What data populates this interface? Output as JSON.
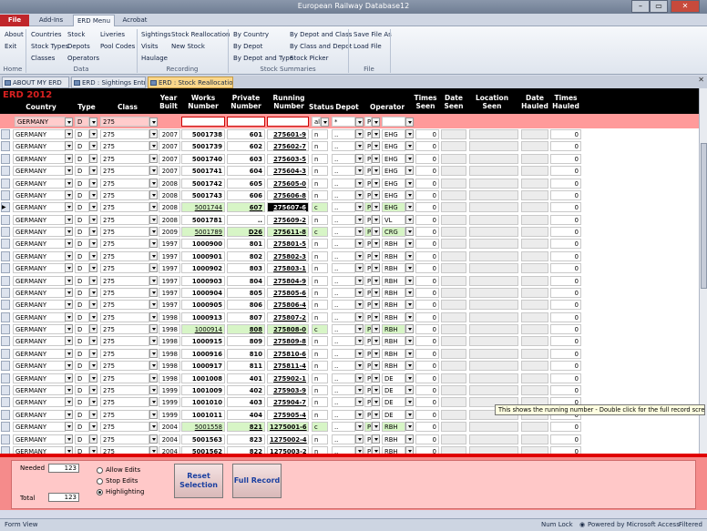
{
  "window": {
    "title": "European Railway Database12",
    "min": "–",
    "max": "▭",
    "close": "✕"
  },
  "ribbon_tabs": [
    "File",
    "Add-Ins",
    "ERD Menu",
    "Acrobat"
  ],
  "ribbon": {
    "home": {
      "items": [
        "About",
        "Exit"
      ],
      "label": "Home"
    },
    "data": {
      "items": [
        "Countries",
        "Stock",
        "Liveries",
        "Stock Types",
        "Depots",
        "Pool Codes",
        "Classes",
        "Operators"
      ],
      "label": "Data"
    },
    "recording": {
      "items": [
        "Sightings",
        "Stock Reallocation",
        "Visits",
        "New Stock",
        "Haulage"
      ],
      "label": "Recording"
    },
    "summaries": {
      "items": [
        "By Country",
        "By Depot and Class",
        "By Depot",
        "By Class and Depot",
        "By Depot and Type",
        "Stock Picker"
      ],
      "label": "Stock Summaries"
    },
    "file": {
      "items": [
        "Save File As",
        "Load File"
      ],
      "label": "File"
    }
  },
  "doc_tabs": [
    "ABOUT MY ERD",
    "ERD : Sightings Entry",
    "ERD : Stock Reallocation"
  ],
  "form": {
    "title": "ERD 2012"
  },
  "headers": {
    "country": "Country",
    "type": "Type",
    "class": "Class",
    "year": [
      "Year",
      "Built"
    ],
    "works": [
      "Works",
      "Number"
    ],
    "private": [
      "Private",
      "Number"
    ],
    "running": [
      "Running",
      "Number"
    ],
    "status": "Status",
    "depot": "Depot",
    "operator": "Operator",
    "times_seen": [
      "Times",
      "Seen"
    ],
    "date_seen": [
      "Date",
      "Seen"
    ],
    "location": [
      "Location",
      "Seen"
    ],
    "date_hauled": [
      "Date",
      "Hauled"
    ],
    "times_hauled": [
      "Times",
      "Hauled"
    ]
  },
  "filter": {
    "country": "GERMANY",
    "type": "D",
    "class": "275",
    "status": "all",
    "depot": "*",
    "operator": "P"
  },
  "rows": [
    {
      "country": "GERMANY",
      "type": "D",
      "class": "275",
      "year": "2007",
      "works": "5001738",
      "private": "601",
      "running": "275601-9",
      "status": "n",
      "depot": "..",
      "op": "P",
      "operator": "EHG",
      "seen": "0",
      "hauled": "0",
      "hl": false
    },
    {
      "country": "GERMANY",
      "type": "D",
      "class": "275",
      "year": "2007",
      "works": "5001739",
      "private": "602",
      "running": "275602-7",
      "status": "n",
      "depot": "..",
      "op": "P",
      "operator": "EHG",
      "seen": "0",
      "hauled": "0",
      "hl": false
    },
    {
      "country": "GERMANY",
      "type": "D",
      "class": "275",
      "year": "2007",
      "works": "5001740",
      "private": "603",
      "running": "275603-5",
      "status": "n",
      "depot": "..",
      "op": "P",
      "operator": "EHG",
      "seen": "0",
      "hauled": "0",
      "hl": false
    },
    {
      "country": "GERMANY",
      "type": "D",
      "class": "275",
      "year": "2007",
      "works": "5001741",
      "private": "604",
      "running": "275604-3",
      "status": "n",
      "depot": "..",
      "op": "P",
      "operator": "EHG",
      "seen": "0",
      "hauled": "0",
      "hl": false
    },
    {
      "country": "GERMANY",
      "type": "D",
      "class": "275",
      "year": "2008",
      "works": "5001742",
      "private": "605",
      "running": "275605-0",
      "status": "n",
      "depot": "..",
      "op": "P",
      "operator": "EHG",
      "seen": "0",
      "hauled": "0",
      "hl": false
    },
    {
      "country": "GERMANY",
      "type": "D",
      "class": "275",
      "year": "2008",
      "works": "5001743",
      "private": "606",
      "running": "275606-8",
      "status": "n",
      "depot": "..",
      "op": "P",
      "operator": "EHG",
      "seen": "0",
      "hauled": "0",
      "hl": false
    },
    {
      "country": "GERMANY",
      "type": "D",
      "class": "275",
      "year": "2008",
      "works": "5001744",
      "private": "607",
      "running": "275607-6",
      "status": "c",
      "depot": "..",
      "op": "P",
      "operator": "EHG",
      "seen": "0",
      "hauled": "0",
      "hl": true,
      "current": true
    },
    {
      "country": "GERMANY",
      "type": "D",
      "class": "275",
      "year": "2008",
      "works": "5001781",
      "private": "..",
      "running": "275609-2",
      "status": "n",
      "depot": "..",
      "op": "P",
      "operator": "VL",
      "seen": "0",
      "hauled": "0",
      "hl": false
    },
    {
      "country": "GERMANY",
      "type": "D",
      "class": "275",
      "year": "2009",
      "works": "5001789",
      "private": "D26",
      "running": "275611-8",
      "status": "c",
      "depot": "..",
      "op": "P",
      "operator": "CRG",
      "seen": "0",
      "hauled": "0",
      "hl": true
    },
    {
      "country": "GERMANY",
      "type": "D",
      "class": "275",
      "year": "1997",
      "works": "1000900",
      "private": "801",
      "running": "275801-5",
      "status": "n",
      "depot": "..",
      "op": "P",
      "operator": "RBH",
      "seen": "0",
      "hauled": "0",
      "hl": false
    },
    {
      "country": "GERMANY",
      "type": "D",
      "class": "275",
      "year": "1997",
      "works": "1000901",
      "private": "802",
      "running": "275802-3",
      "status": "n",
      "depot": "..",
      "op": "P",
      "operator": "RBH",
      "seen": "0",
      "hauled": "0",
      "hl": false
    },
    {
      "country": "GERMANY",
      "type": "D",
      "class": "275",
      "year": "1997",
      "works": "1000902",
      "private": "803",
      "running": "275803-1",
      "status": "n",
      "depot": "..",
      "op": "P",
      "operator": "RBH",
      "seen": "0",
      "hauled": "0",
      "hl": false
    },
    {
      "country": "GERMANY",
      "type": "D",
      "class": "275",
      "year": "1997",
      "works": "1000903",
      "private": "804",
      "running": "275804-9",
      "status": "n",
      "depot": "..",
      "op": "P",
      "operator": "RBH",
      "seen": "0",
      "hauled": "0",
      "hl": false
    },
    {
      "country": "GERMANY",
      "type": "D",
      "class": "275",
      "year": "1997",
      "works": "1000904",
      "private": "805",
      "running": "275805-6",
      "status": "n",
      "depot": "..",
      "op": "P",
      "operator": "RBH",
      "seen": "0",
      "hauled": "0",
      "hl": false
    },
    {
      "country": "GERMANY",
      "type": "D",
      "class": "275",
      "year": "1997",
      "works": "1000905",
      "private": "806",
      "running": "275806-4",
      "status": "n",
      "depot": "..",
      "op": "P",
      "operator": "RBH",
      "seen": "0",
      "hauled": "0",
      "hl": false
    },
    {
      "country": "GERMANY",
      "type": "D",
      "class": "275",
      "year": "1998",
      "works": "1000913",
      "private": "807",
      "running": "275807-2",
      "status": "n",
      "depot": "..",
      "op": "P",
      "operator": "RBH",
      "seen": "0",
      "hauled": "0",
      "hl": false
    },
    {
      "country": "GERMANY",
      "type": "D",
      "class": "275",
      "year": "1998",
      "works": "1000914",
      "private": "808",
      "running": "275808-0",
      "status": "c",
      "depot": "..",
      "op": "P",
      "operator": "RBH",
      "seen": "0",
      "hauled": "0",
      "hl": true
    },
    {
      "country": "GERMANY",
      "type": "D",
      "class": "275",
      "year": "1998",
      "works": "1000915",
      "private": "809",
      "running": "275809-8",
      "status": "n",
      "depot": "..",
      "op": "P",
      "operator": "RBH",
      "seen": "0",
      "hauled": "0",
      "hl": false
    },
    {
      "country": "GERMANY",
      "type": "D",
      "class": "275",
      "year": "1998",
      "works": "1000916",
      "private": "810",
      "running": "275810-6",
      "status": "n",
      "depot": "..",
      "op": "P",
      "operator": "RBH",
      "seen": "0",
      "hauled": "0",
      "hl": false
    },
    {
      "country": "GERMANY",
      "type": "D",
      "class": "275",
      "year": "1998",
      "works": "1000917",
      "private": "811",
      "running": "275811-4",
      "status": "n",
      "depot": "..",
      "op": "P",
      "operator": "RBH",
      "seen": "0",
      "hauled": "0",
      "hl": false
    },
    {
      "country": "GERMANY",
      "type": "D",
      "class": "275",
      "year": "1998",
      "works": "1001008",
      "private": "401",
      "running": "275902-1",
      "status": "n",
      "depot": "..",
      "op": "P",
      "operator": "DE",
      "seen": "0",
      "hauled": "0",
      "hl": false
    },
    {
      "country": "GERMANY",
      "type": "D",
      "class": "275",
      "year": "1999",
      "works": "1001009",
      "private": "402",
      "running": "275903-9",
      "status": "n",
      "depot": "..",
      "op": "P",
      "operator": "DE",
      "seen": "0",
      "hauled": "0",
      "hl": false
    },
    {
      "country": "GERMANY",
      "type": "D",
      "class": "275",
      "year": "1999",
      "works": "1001010",
      "private": "403",
      "running": "275904-7",
      "status": "n",
      "depot": "..",
      "op": "P",
      "operator": "DE",
      "seen": "0",
      "hauled": "0",
      "hl": false
    },
    {
      "country": "GERMANY",
      "type": "D",
      "class": "275",
      "year": "1999",
      "works": "1001011",
      "private": "404",
      "running": "275905-4",
      "status": "n",
      "depot": "..",
      "op": "P",
      "operator": "DE",
      "seen": "0",
      "hauled": "0",
      "hl": false
    },
    {
      "country": "GERMANY",
      "type": "D",
      "class": "275",
      "year": "2004",
      "works": "5001558",
      "private": "821",
      "running": "1275001-6",
      "status": "c",
      "depot": "..",
      "op": "P",
      "operator": "RBH",
      "seen": "0",
      "hauled": "0",
      "hl": true
    },
    {
      "country": "GERMANY",
      "type": "D",
      "class": "275",
      "year": "2004",
      "works": "5001563",
      "private": "823",
      "running": "1275002-4",
      "status": "n",
      "depot": "..",
      "op": "P",
      "operator": "RBH",
      "seen": "0",
      "hauled": "0",
      "hl": false
    },
    {
      "country": "GERMANY",
      "type": "D",
      "class": "275",
      "year": "2004",
      "works": "5001562",
      "private": "822",
      "running": "1275003-2",
      "status": "n",
      "depot": "..",
      "op": "P",
      "operator": "RBH",
      "seen": "0",
      "hauled": "0",
      "hl": false
    }
  ],
  "footer": {
    "needed_label": "Needed",
    "needed_value": "123",
    "total_label": "Total",
    "total_value": "123",
    "radios": [
      "Allow Edits",
      "Stop Edits",
      "Highlighting"
    ],
    "reset_button": "Reset\nSelection",
    "full_record_button": "Full Record"
  },
  "tooltip": "This shows the running number - Double click for the full record screen",
  "status_bar": {
    "left": "Form View",
    "num_lock": "Num Lock",
    "powered": "Powered by Microsoft Access",
    "filtered": "Filtered"
  },
  "colors": {
    "header_bg": "#000000",
    "title_red": "#d82020",
    "filter_row": "#ff9a9a",
    "highlight_row": "#d7f5c6",
    "footer_bg": "#f58b8b",
    "divider": "#e00000"
  }
}
